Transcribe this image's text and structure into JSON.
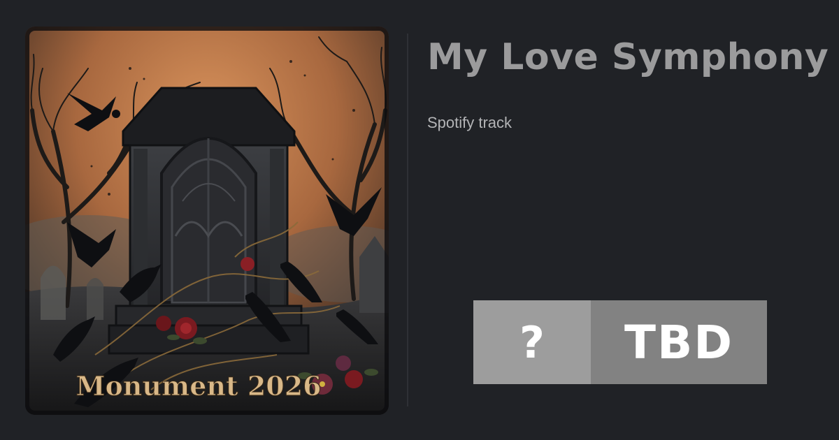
{
  "track": {
    "title": "My Love Symphony",
    "subtitle": "Spotify track"
  },
  "cover_art": {
    "caption": "Monument 2026"
  },
  "badge": {
    "label": "?",
    "message": "TBD",
    "label_color": "#9d9d9d",
    "message_color": "#828282"
  },
  "theme": {
    "background": "#202226",
    "title_color": "#9b9b9c",
    "subtitle_color": "#b3b4b6"
  }
}
